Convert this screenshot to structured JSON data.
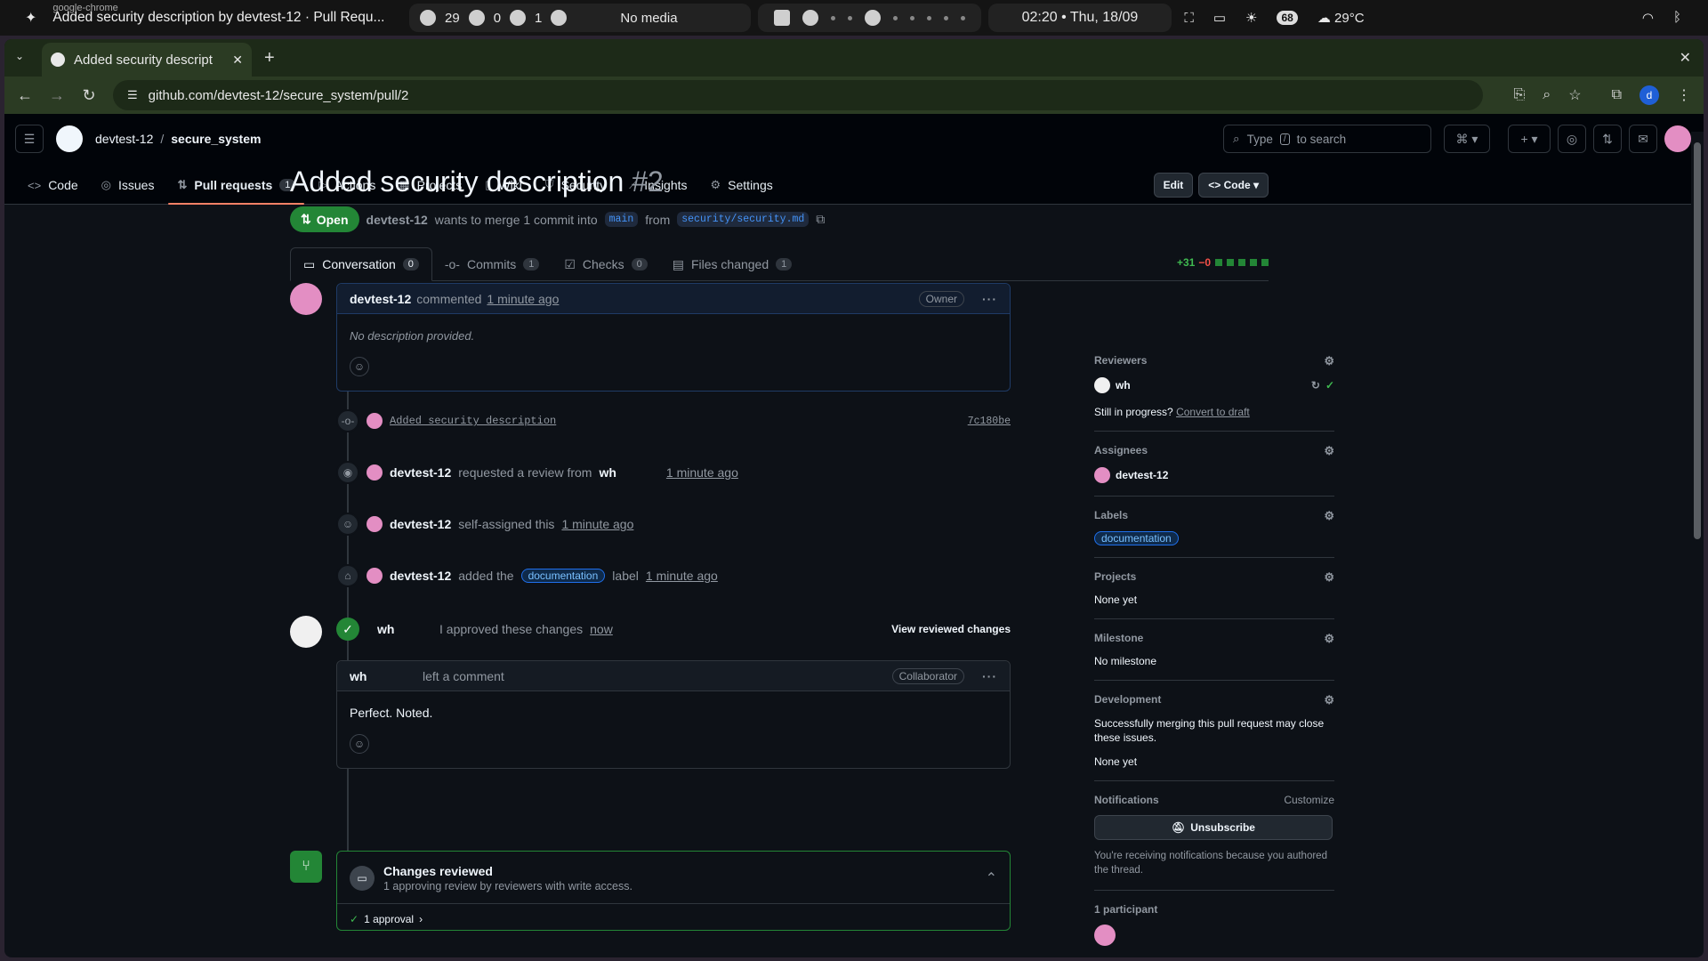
{
  "system": {
    "app_small": "google-chrome",
    "window_title": "Added security description by devtest-12 · Pull Requ...",
    "stat1": "29",
    "stat2": "0",
    "stat3": "1",
    "media": "No media",
    "clock": "02:20 • Thu, 18/09",
    "battery": "68",
    "weather": "29°C"
  },
  "browser": {
    "tab_title": "Added security descript",
    "url": "github.com/devtest-12/secure_system/pull/2",
    "profile_initial": "d"
  },
  "gh": {
    "owner": "devtest-12",
    "repo": "secure_system",
    "search_placeholder_pre": "Type",
    "search_key": "/",
    "search_placeholder_post": "to search",
    "tabs": [
      {
        "label": "Code"
      },
      {
        "label": "Issues"
      },
      {
        "label": "Pull requests",
        "count": "1"
      },
      {
        "label": "Actions"
      },
      {
        "label": "Projects"
      },
      {
        "label": "Wiki"
      },
      {
        "label": "Security"
      },
      {
        "label": "Insights"
      },
      {
        "label": "Settings"
      }
    ]
  },
  "pr": {
    "title": "Added security description",
    "number": "#2",
    "edit_label": "Edit",
    "code_label": "Code",
    "state": "Open",
    "author": "devtest-12",
    "merge_text": "wants to merge 1 commit into",
    "base": "main",
    "from_text": "from",
    "head": "security/security.md",
    "tabs": [
      {
        "label": "Conversation",
        "count": "0"
      },
      {
        "label": "Commits",
        "count": "1"
      },
      {
        "label": "Checks",
        "count": "0"
      },
      {
        "label": "Files changed",
        "count": "1"
      }
    ],
    "additions": "+31",
    "deletions": "−0"
  },
  "timeline": {
    "c1_author": "devtest-12",
    "c1_action": "commented",
    "c1_time": "1 minute ago",
    "c1_role": "Owner",
    "c1_body": "No description provided.",
    "commit_msg": "Added security description",
    "commit_sha": "7c180be",
    "ev_review_author": "devtest-12",
    "ev_review_text": "requested a review from",
    "ev_review_target": "wh",
    "ev_review_time": "1 minute ago",
    "ev_assign_author": "devtest-12",
    "ev_assign_text": "self-assigned this",
    "ev_assign_time": "1 minute ago",
    "ev_label_author": "devtest-12",
    "ev_label_text": "added the",
    "ev_label_name": "documentation",
    "ev_label_suffix": "label",
    "ev_label_time": "1 minute ago",
    "approve_author": "wh",
    "approve_text": "I approved these changes",
    "approve_time": "now",
    "view_changes": "View reviewed changes",
    "c2_author": "wh",
    "c2_action": "left a comment",
    "c2_role": "Collaborator",
    "c2_body": "Perfect. Noted.",
    "merge_title": "Changes reviewed",
    "merge_sub": "1 approving review by reviewers with write access.",
    "approvals": "1 approval"
  },
  "sidebar": {
    "reviewers_title": "Reviewers",
    "reviewer": "wh",
    "in_progress": "Still in progress?",
    "draft_link": "Convert to draft",
    "assignees_title": "Assignees",
    "assignee": "devtest-12",
    "labels_title": "Labels",
    "label": "documentation",
    "projects_title": "Projects",
    "projects_val": "None yet",
    "milestone_title": "Milestone",
    "milestone_val": "No milestone",
    "dev_title": "Development",
    "dev_text": "Successfully merging this pull request may close these issues.",
    "dev_val": "None yet",
    "notif_title": "Notifications",
    "customize": "Customize",
    "unsubscribe": "Unsubscribe",
    "notif_text": "You're receiving notifications because you authored the thread.",
    "participants": "1 participant"
  },
  "colors": {
    "accent_green": "#238636",
    "link_blue": "#4493f8",
    "tab_underline": "#f78166"
  }
}
